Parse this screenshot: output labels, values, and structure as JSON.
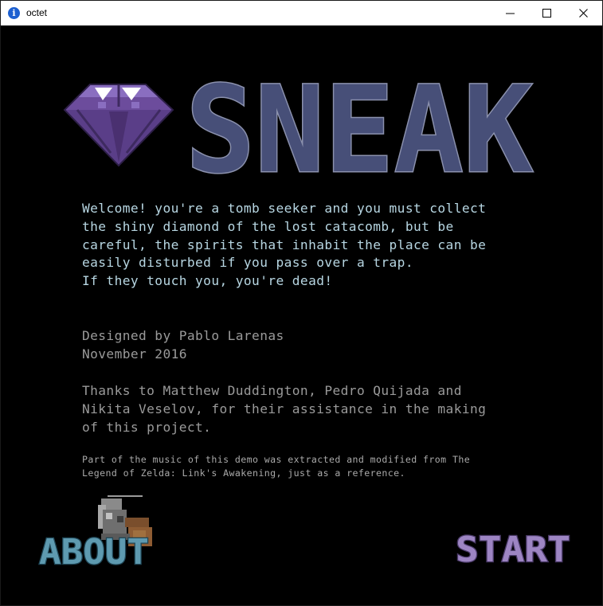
{
  "window": {
    "title": "octet",
    "controls": [
      "minimize-icon",
      "maximize-icon",
      "close-icon"
    ]
  },
  "game": {
    "logo_text": "SNEAK",
    "intro_lines": [
      "Welcome! you're a tomb seeker and you must collect",
      "the shiny diamond of the lost catacomb, but be",
      "careful, the spirits that inhabit the place can be",
      "easily disturbed if you pass over a trap.",
      "If they touch you, you're dead!"
    ],
    "credits_lines": [
      "Designed by Pablo Larenas",
      "November 2016"
    ],
    "thanks_lines": [
      "Thanks to Matthew Duddington, Pedro Quijada and",
      "Nikita Veselov, for their assistance in the making",
      "of this project."
    ],
    "music_lines": [
      "Part of the music of this demo was extracted and modified from The",
      "Legend of Zelda: Link's Awakening, just as a reference."
    ],
    "buttons": {
      "about": "ABOUT",
      "start": "START"
    },
    "colors": {
      "background": "#000000",
      "intro_text": "#b7d6e2",
      "secondary_text": "#9a9a9a",
      "logo_fill": "#474f78",
      "gem": "#6c4c9c",
      "about_button": "#5e9ab0",
      "start_button": "#9d85c3"
    }
  }
}
